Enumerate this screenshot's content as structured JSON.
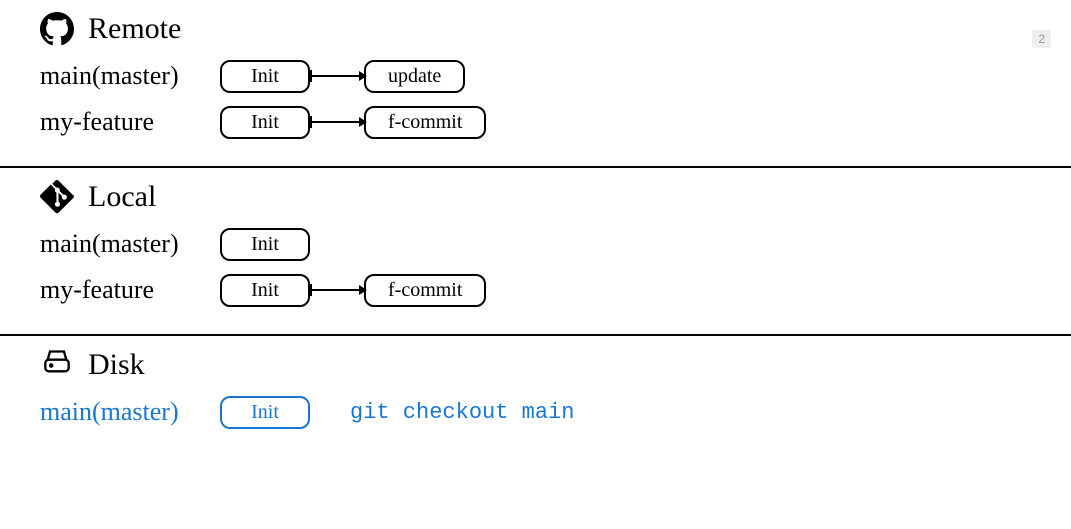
{
  "badge": "2",
  "sections": {
    "remote": {
      "title": "Remote",
      "branches": [
        {
          "label": "main(master)",
          "commits": [
            "Init",
            "update"
          ]
        },
        {
          "label": "my-feature",
          "commits": [
            "Init",
            "f-commit"
          ]
        }
      ]
    },
    "local": {
      "title": "Local",
      "branches": [
        {
          "label": "main(master)",
          "commits": [
            "Init"
          ]
        },
        {
          "label": "my-feature",
          "commits": [
            "Init",
            "f-commit"
          ]
        }
      ]
    },
    "disk": {
      "title": "Disk",
      "branches": [
        {
          "label": "main(master)",
          "commits": [
            "Init"
          ],
          "command": "git checkout main"
        }
      ]
    }
  }
}
